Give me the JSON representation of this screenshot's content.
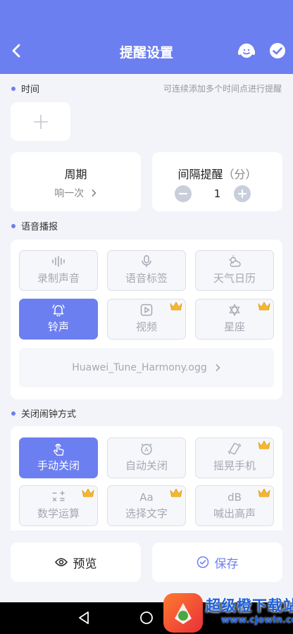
{
  "header": {
    "title": "提醒设置"
  },
  "time_section": {
    "title": "时间",
    "hint": "可连续添加多个时间点进行提醒"
  },
  "period": {
    "label": "周期",
    "value": "响一次"
  },
  "interval": {
    "label": "间隔提醒",
    "unit": "（分）",
    "value": "1"
  },
  "voice_section": {
    "title": "语音播报",
    "options": [
      {
        "label": "录制声音",
        "icon": "waveform-icon",
        "active": false,
        "vip": false
      },
      {
        "label": "语音标签",
        "icon": "microphone-icon",
        "active": false,
        "vip": false
      },
      {
        "label": "天气日历",
        "icon": "weather-icon",
        "active": false,
        "vip": false
      },
      {
        "label": "铃声",
        "icon": "bell-icon",
        "active": true,
        "vip": false
      },
      {
        "label": "视频",
        "icon": "video-icon",
        "active": false,
        "vip": true
      },
      {
        "label": "星座",
        "icon": "star-of-david-icon",
        "active": false,
        "vip": true
      }
    ],
    "ringtone": "Huawei_Tune_Harmony.ogg"
  },
  "alarm_section": {
    "title": "关闭闹钟方式",
    "options": [
      {
        "label": "手动关闭",
        "icon": "hand-tap-icon",
        "active": true,
        "vip": false
      },
      {
        "label": "自动关闭",
        "icon": "auto-clock-icon",
        "active": false,
        "vip": false
      },
      {
        "label": "摇晃手机",
        "icon": "shake-phone-icon",
        "active": false,
        "vip": true
      },
      {
        "label": "数学运算",
        "icon": "math-icon",
        "active": false,
        "vip": true
      },
      {
        "label": "选择文字",
        "icon": "text-aa-icon",
        "active": false,
        "vip": true
      },
      {
        "label": "喊出高声",
        "icon": "decibel-icon",
        "active": false,
        "vip": true
      }
    ]
  },
  "bottom": {
    "preview": "预览",
    "save": "保存"
  },
  "watermark": {
    "name": "超级橙下载站",
    "url": "www.cjowin.com"
  },
  "colors": {
    "accent": "#6c7ff0",
    "background": "#f3f4f9",
    "vip_crown": "#f5b82e"
  }
}
